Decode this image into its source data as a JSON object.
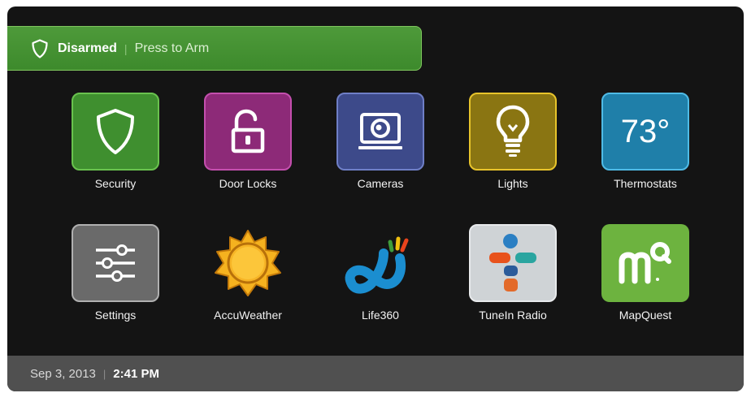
{
  "arm_bar": {
    "status": "Disarmed",
    "action": "Press to Arm",
    "icon": "shield-icon"
  },
  "apps": [
    {
      "label": "Security",
      "icon": "shield-icon",
      "color": "#3f8f2f"
    },
    {
      "label": "Door Locks",
      "icon": "lock-open-icon",
      "color": "#8d2a78"
    },
    {
      "label": "Cameras",
      "icon": "camera-icon",
      "color": "#3d4a8a"
    },
    {
      "label": "Lights",
      "icon": "lightbulb-icon",
      "color": "#8a7512"
    },
    {
      "label": "Thermostats",
      "icon": "temperature-icon",
      "color": "#1f7fa9",
      "value": "73°"
    },
    {
      "label": "Settings",
      "icon": "sliders-icon",
      "color": "#6a6a6a"
    },
    {
      "label": "AccuWeather",
      "icon": "sun-icon",
      "color": "#f2a81a"
    },
    {
      "label": "Life360",
      "icon": "life360-logo-icon",
      "color": "#1b8ed0"
    },
    {
      "label": "TuneIn Radio",
      "icon": "tunein-logo-icon",
      "color": "#cfd3d6"
    },
    {
      "label": "MapQuest",
      "icon": "mapquest-logo-icon",
      "color": "#6db33f"
    }
  ],
  "status_bar": {
    "date": "Sep 3, 2013",
    "time": "2:41 PM"
  }
}
